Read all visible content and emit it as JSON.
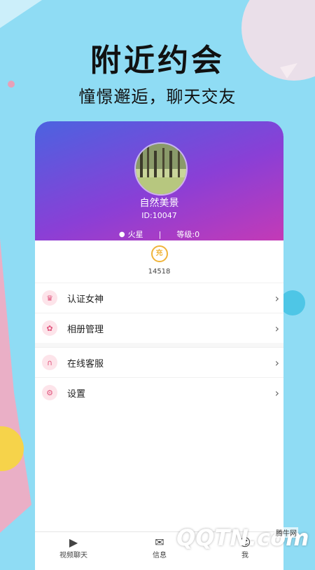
{
  "promo": {
    "title": "附近约会",
    "subtitle": "憧憬邂逅，聊天交友"
  },
  "profile": {
    "nickname": "自然美景",
    "id_text": "ID:10047",
    "location": "火星",
    "separator": "|",
    "level": "等级:0",
    "coin_icon_text": "充",
    "coin_count": "14518"
  },
  "menu": {
    "items": [
      {
        "label": "认证女神",
        "icon": "crown-icon"
      },
      {
        "label": "相册管理",
        "icon": "album-icon"
      },
      {
        "label": "在线客服",
        "icon": "headset-icon"
      },
      {
        "label": "设置",
        "icon": "gear-icon"
      }
    ]
  },
  "tabbar": {
    "tabs": [
      {
        "label": "视频聊天"
      },
      {
        "label": "信息"
      },
      {
        "label": "我"
      }
    ]
  },
  "watermark": {
    "logo": "QQTN.com",
    "small": "腾牛网"
  },
  "colors": {
    "background": "#8fdcf4",
    "header_gradient_start": "#4b63e0",
    "header_gradient_end": "#c43ab6",
    "accent_pink": "#e0557d",
    "coin_gold": "#f0b43a"
  }
}
